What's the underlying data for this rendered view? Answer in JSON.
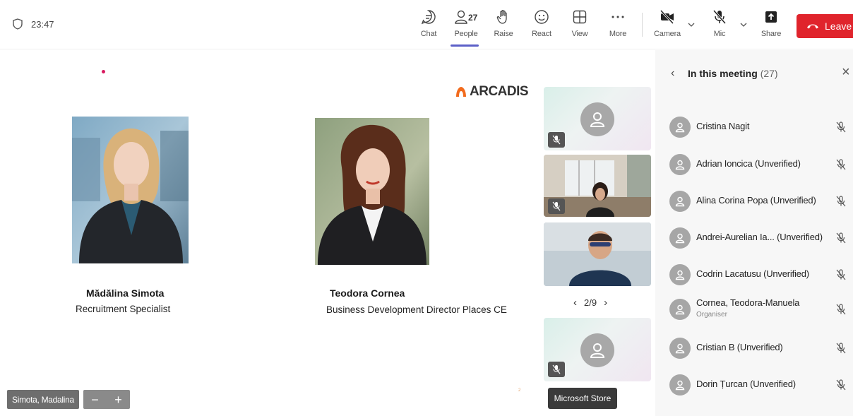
{
  "meeting": {
    "timer": "23:47"
  },
  "toolbar": {
    "chat_label": "Chat",
    "people_label": "People",
    "people_count": "27",
    "raise_label": "Raise",
    "react_label": "React",
    "view_label": "View",
    "more_label": "More",
    "camera_label": "Camera",
    "mic_label": "Mic",
    "share_label": "Share",
    "leave_label": "Leave",
    "accent": "#5b5fc7",
    "leave_color": "#e0242c"
  },
  "slide": {
    "logo_text": "ARCADIS",
    "logo_color": "#f26b1d",
    "people": [
      {
        "name": "Mădălina Simota",
        "role": "Recruitment Specialist"
      },
      {
        "name": "Teodora Cornea",
        "role": "Business Development Director Places CE"
      }
    ]
  },
  "stage": {
    "presenter_badge": "Simota, Madalina",
    "zoom_out": "−",
    "zoom_in": "+"
  },
  "video_strip": {
    "pager_text": "2/9",
    "tooltip": "Microsoft Store"
  },
  "panel": {
    "title": "In this meeting",
    "count": "(27)",
    "participants": [
      {
        "name": "Cristina Nagit",
        "sub": ""
      },
      {
        "name": "Adrian Ioncica (Unverified)",
        "sub": ""
      },
      {
        "name": "Alina Corina Popa (Unverified)",
        "sub": ""
      },
      {
        "name": "Andrei-Aurelian Ia... (Unverified)",
        "sub": ""
      },
      {
        "name": "Codrin Lacatusu (Unverified)",
        "sub": ""
      },
      {
        "name": "Cornea, Teodora-Manuela",
        "sub": "Organiser"
      },
      {
        "name": "Cristian B (Unverified)",
        "sub": ""
      },
      {
        "name": "Dorin Țurcan (Unverified)",
        "sub": ""
      }
    ]
  }
}
